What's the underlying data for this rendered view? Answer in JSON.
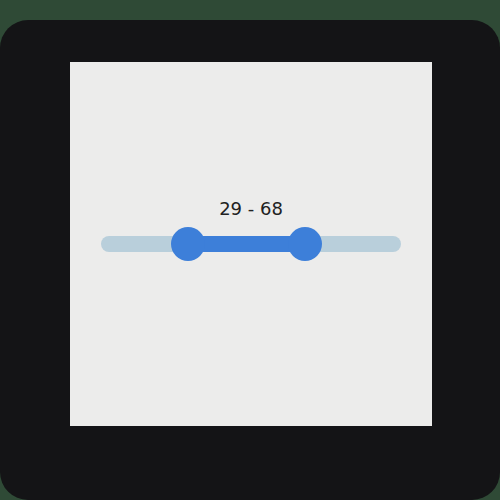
{
  "screen": {
    "slider": {
      "label": "29 - 68",
      "start": 0.29,
      "level": 0.39
    }
  }
}
